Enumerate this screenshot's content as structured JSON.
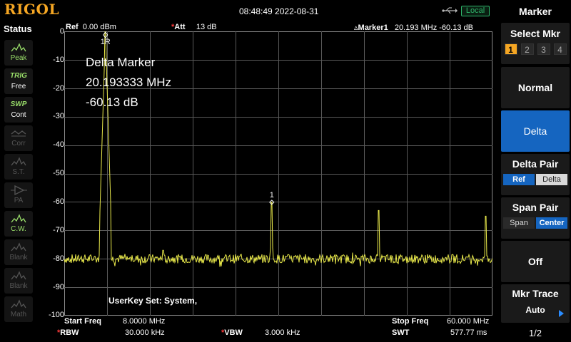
{
  "topbar": {
    "logo": "RIGOL",
    "datetime": "08:48:49 2022-08-31",
    "local_badge": "Local"
  },
  "status": {
    "title": "Status",
    "items": [
      {
        "label": "Peak",
        "icon": "peak-icon",
        "state": "on"
      },
      {
        "label": "Free",
        "icon_text": "TRIG",
        "state": "on2"
      },
      {
        "label": "Cont",
        "icon_text": "SWP",
        "state": "on2"
      },
      {
        "label": "Corr",
        "icon": "corr-icon",
        "state": "off"
      },
      {
        "label": "S.T.",
        "icon": "st-icon",
        "state": "off"
      },
      {
        "label": "PA",
        "icon": "pa-icon",
        "state": "off"
      },
      {
        "label": "C.W.",
        "icon": "cw-icon",
        "state": "on"
      },
      {
        "label": "Blank",
        "icon": "blank-icon",
        "state": "off"
      },
      {
        "label": "Blank",
        "icon": "blank-icon",
        "state": "off"
      },
      {
        "label": "Math",
        "icon": "math-icon",
        "state": "off"
      }
    ]
  },
  "header": {
    "ref_label": "Ref",
    "ref_value": "0.00 dBm",
    "att_label": "Att",
    "att_value": "13 dB",
    "marker_label": "Marker1",
    "marker_value": "20.193 MHz   -60.13 dB"
  },
  "y_axis": {
    "ticks": [
      "0",
      "-10",
      "-20",
      "-30",
      "-40",
      "-50",
      "-60",
      "-70",
      "-80",
      "-90",
      "-100"
    ]
  },
  "delta_marker": {
    "title": "Delta Marker",
    "freq": "20.193333 MHz",
    "level": "-60.13 dB"
  },
  "marker_labels": {
    "ref": "1R",
    "m1": "1"
  },
  "userkey": "UserKey Set:   System,",
  "footer": {
    "start_label": "Start Freq",
    "start_value": "8.0000 MHz",
    "stop_label": "Stop Freq",
    "stop_value": "60.000 MHz",
    "rbw_label": "RBW",
    "rbw_value": "30.000 kHz",
    "vbw_label": "VBW",
    "vbw_value": "3.000 kHz",
    "swt_label": "SWT",
    "swt_value": "577.77 ms"
  },
  "menu": {
    "title": "Marker",
    "select_mkr": "Select Mkr",
    "mkr_numbers": [
      "1",
      "2",
      "3",
      "4"
    ],
    "normal": "Normal",
    "delta": "Delta",
    "delta_pair": "Delta Pair",
    "delta_pair_opts": [
      "Ref",
      "Delta"
    ],
    "span_pair": "Span Pair",
    "span_pair_opts": [
      "Span",
      "Center"
    ],
    "off": "Off",
    "mkr_trace": "Mkr Trace",
    "mkr_trace_value": "Auto",
    "page": "1/2"
  },
  "chart_data": {
    "type": "line",
    "xlabel": "",
    "ylabel": "",
    "xlim": [
      8.0,
      60.0
    ],
    "ylim": [
      -100,
      0
    ],
    "x_unit": "MHz",
    "y_unit": "dBm",
    "noise_floor": -80,
    "peaks": [
      {
        "x": 13.0,
        "y": 0.0
      },
      {
        "x": 20.0,
        "y": -77
      },
      {
        "x": 33.2,
        "y": -60.13
      },
      {
        "x": 46.2,
        "y": -63
      },
      {
        "x": 59.2,
        "y": -65
      }
    ],
    "grid": true,
    "trace_color": "#e8e84a"
  }
}
